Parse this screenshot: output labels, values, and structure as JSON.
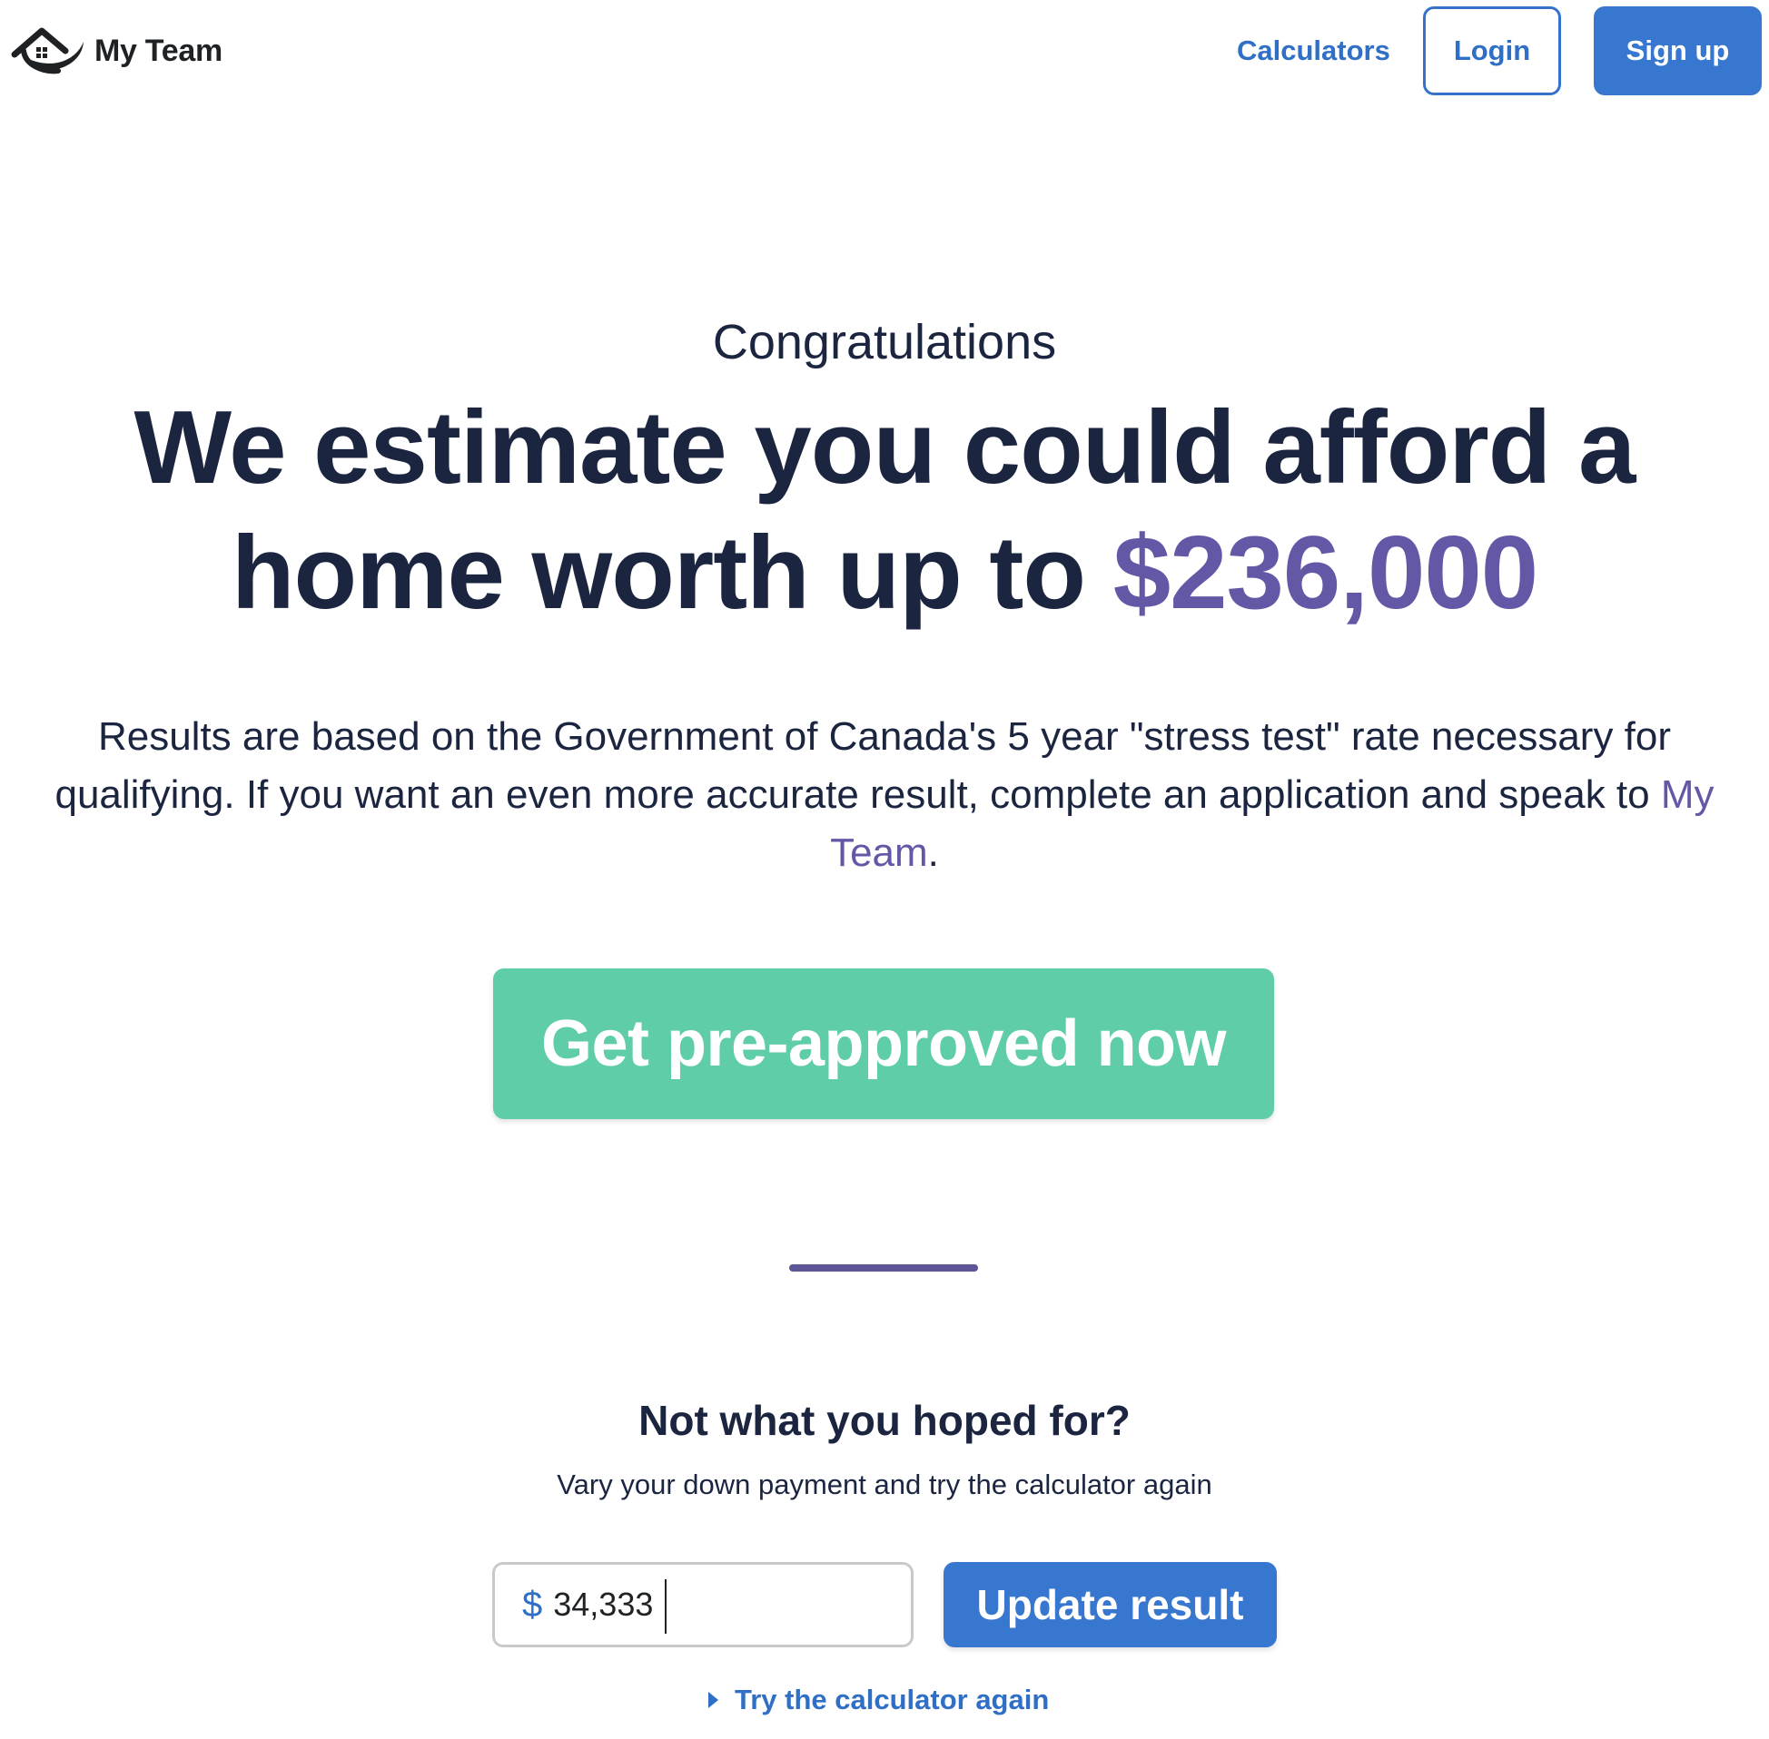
{
  "brand": {
    "name": "My Team",
    "icon": "house-logo-icon"
  },
  "nav": {
    "calculators": "Calculators",
    "login": "Login",
    "signup": "Sign up"
  },
  "hero": {
    "eyebrow": "Congratulations",
    "headline_prefix": "We estimate you could afford a home worth up to ",
    "headline_amount": "$236,000",
    "disclaimer_text": "Results are based on the Government of Canada's 5 year \"stress test\" rate necessary for qualifying. If you want an even more accurate result, complete an application and speak to ",
    "disclaimer_link": "My Team",
    "disclaimer_end": ".",
    "cta": "Get pre-approved now"
  },
  "retry": {
    "title": "Not what you hoped for?",
    "subtitle": "Vary your down payment and try the calculator again",
    "currency": "$",
    "down_payment_value": "34,333",
    "update_button": "Update result",
    "link": "Try the calculator again",
    "link_icon": "caret-right-icon"
  },
  "colors": {
    "primary_blue": "#3877cf",
    "link_blue": "#2f6fc6",
    "accent_purple": "#6358a6",
    "cta_green": "#5ecda8",
    "text_dark": "#1b2540"
  }
}
